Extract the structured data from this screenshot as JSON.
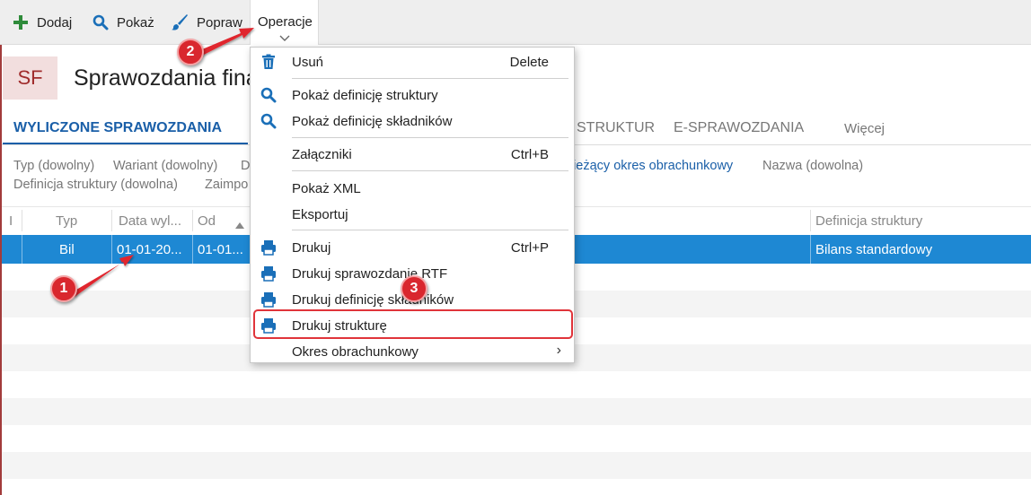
{
  "toolbar": {
    "add_label": "Dodaj",
    "show_label": "Pokaż",
    "edit_label": "Popraw",
    "operations_label": "Operacje"
  },
  "header": {
    "badge": "SF",
    "title": "Sprawozdania finansowe"
  },
  "tabs": {
    "active": "WYLICZONE SPRAWOZDANIA",
    "structures": "STRUKTUR",
    "e_reports": "E-SPRAWOZDANIA",
    "more": "Więcej"
  },
  "filters": {
    "type": "Typ (dowolny)",
    "variant": "Wariant (dowolny)",
    "d": "D",
    "period": "bieżący okres obrachunkowy",
    "name": "Nazwa (dowolna)",
    "structure_def": "Definicja struktury (dowolna)",
    "imported": "Zaimpo"
  },
  "grid": {
    "col_i": "I",
    "col_type": "Typ",
    "col_date": "Data wyl...",
    "col_from": "Od",
    "col_structure": "Definicja struktury",
    "row": {
      "type": "Bil",
      "date": "01-01-20...",
      "from": "01-01...",
      "structure": "Bilans standardowy"
    }
  },
  "menu": {
    "items": [
      {
        "label": "Usuń",
        "shortcut": "Delete",
        "icon": "trash-icon"
      },
      {
        "label": "Pokaż definicję struktury",
        "shortcut": "",
        "icon": "search-icon"
      },
      {
        "label": "Pokaż definicję składników",
        "shortcut": "",
        "icon": "search-icon"
      },
      {
        "label": "Załączniki",
        "shortcut": "Ctrl+B",
        "icon": ""
      },
      {
        "label": "Pokaż XML",
        "shortcut": "",
        "icon": ""
      },
      {
        "label": "Eksportuj",
        "shortcut": "",
        "icon": ""
      },
      {
        "label": "Drukuj",
        "shortcut": "Ctrl+P",
        "icon": "printer-icon"
      },
      {
        "label": "Drukuj sprawozdanie RTF",
        "shortcut": "",
        "icon": "printer-icon"
      },
      {
        "label": "Drukuj definicję składników",
        "shortcut": "",
        "icon": "printer-icon"
      },
      {
        "label": "Drukuj strukturę",
        "shortcut": "",
        "icon": "printer-icon"
      },
      {
        "label": "Okres obrachunkowy",
        "shortcut": "",
        "icon": "",
        "submenu_arrow": "›"
      }
    ]
  },
  "annotations": {
    "step1": "1",
    "step2": "2",
    "step3": "3"
  },
  "colors": {
    "accent": "#1a5fa8",
    "selection": "#1e88d3",
    "annotation": "#d9272e",
    "icon_blue": "#1a6fb8",
    "add_green": "#2e8b3a"
  }
}
